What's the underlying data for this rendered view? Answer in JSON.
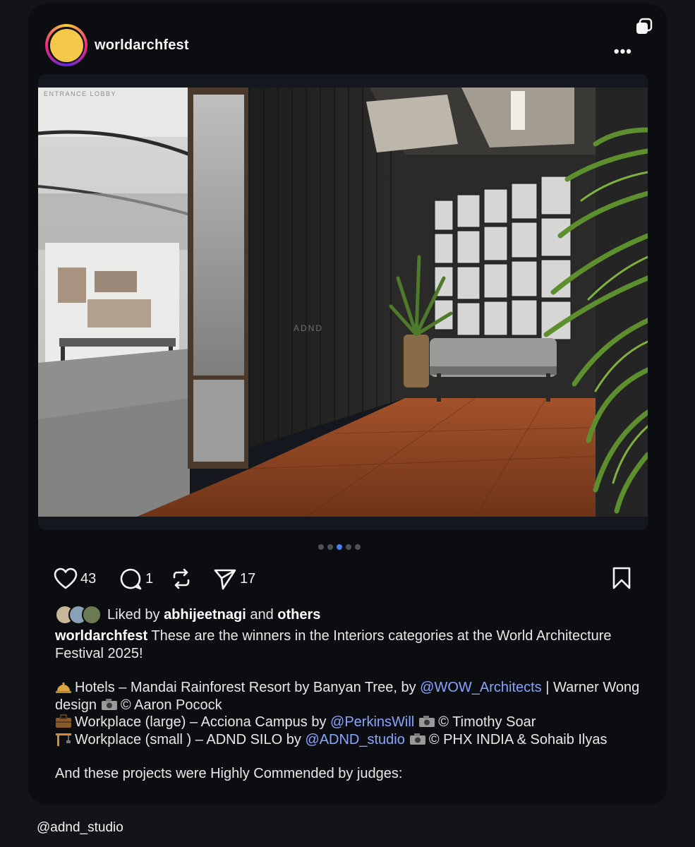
{
  "post": {
    "username": "worldarchfest",
    "photo_caption": "ENTRANCE LOBBY",
    "photo_sign": "ADND",
    "carousel": {
      "total": 5,
      "active_index": 2
    },
    "actions": {
      "likes": "43",
      "comments": "1",
      "shares": "17"
    },
    "liked_by": {
      "prefix": "Liked by",
      "user": "abhijeetnagi",
      "joiner": "and",
      "suffix": "others"
    },
    "caption": {
      "author": "worldarchfest",
      "intro": "These are the winners in the Interiors categories at the World Architecture Festival 2025!",
      "entries": [
        {
          "icon": "bellhop-bell-icon",
          "before": "Hotels – Mandai Rainforest Resort by Banyan Tree, by",
          "mention": "@WOW_Architects",
          "after": "| Warner Wong design",
          "credit": "© Aaron Pocock"
        },
        {
          "icon": "briefcase-icon",
          "before": "Workplace (large) – Acciona Campus by",
          "mention": "@PerkinsWill",
          "after": "",
          "credit": "© Timothy Soar"
        },
        {
          "icon": "construction-crane-icon",
          "before": "Workplace (small ) – ADND SILO by",
          "mention": "@ADND_studio",
          "after": "",
          "credit": "© PHX INDIA & Sohaib Ilyas"
        }
      ],
      "closing": "And these projects were Highly Commended by judges:"
    }
  },
  "source_handle": "@adnd_studio",
  "colors": {
    "background": "#121418",
    "card": "#0b0d11",
    "mention": "#8aa4ff",
    "active_dot": "#4d7cf5"
  }
}
